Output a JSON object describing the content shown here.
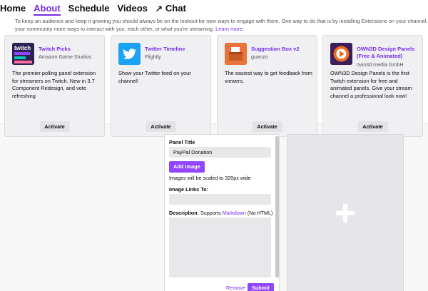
{
  "nav": {
    "tabs": [
      {
        "label": "Home"
      },
      {
        "label": "About"
      },
      {
        "label": "Schedule"
      },
      {
        "label": "Videos"
      },
      {
        "label": "Chat"
      }
    ],
    "active_tab": "About"
  },
  "intro": {
    "line1": "To keep an audience and keep it growing you should always be on the lookout for new ways to engage with them. One way to do that is by installing Extensions on your channel. You ca",
    "line2": "your community more ways to interact with you, each other, or what you're streaming.",
    "learn_more": "Learn more."
  },
  "extensions": [
    {
      "name": "Twitch Picks",
      "author": "Amazon Game Studios",
      "description": "The premier polling panel extension for streamers on Twitch. New in 3.7 Component Redesign, and vote refreshing",
      "button": "Activate",
      "icon": "twitch-picks-logo",
      "logo_text": "twitch"
    },
    {
      "name": "Twitter Timeline",
      "author": "Flightly",
      "description": "Show your Twitter feed on your channel!",
      "button": "Activate",
      "icon": "twitter-bird-logo"
    },
    {
      "name": "Suggestion Box v2",
      "author": "guanzo",
      "description": "The easiest way to get feedback from viewers.",
      "button": "Activate",
      "icon": "suggestion-box-logo"
    },
    {
      "name": "OWN3D Design Panels (Free & Animated)",
      "author": "own3d media GmbH",
      "description": "OWN3D Design Panels is the first Twitch extension for free and animated panels. Give your stream channel a professional look now!",
      "button": "Activate",
      "icon": "own3d-logo"
    }
  ],
  "panel_form": {
    "title_label": "Panel Title",
    "title_value": "PayPal Donation",
    "add_image": "Add Image",
    "image_hint": "Images will be scaled to 320px wide",
    "links_label": "Image Links To:",
    "links_value": "",
    "description_label": "Description:",
    "description_supports": "Supports",
    "markdown_link": "Markdown",
    "no_html": "(No HTML)",
    "description_value": "",
    "remove": "Remove",
    "submit": "Submit"
  },
  "add_panel": {
    "icon": "plus-icon",
    "glyph": "+"
  },
  "colors": {
    "accent": "#772ce8",
    "button_purple": "#9147ff",
    "twitter_blue": "#1da1f2",
    "owned_orange": "#f26b1d"
  }
}
